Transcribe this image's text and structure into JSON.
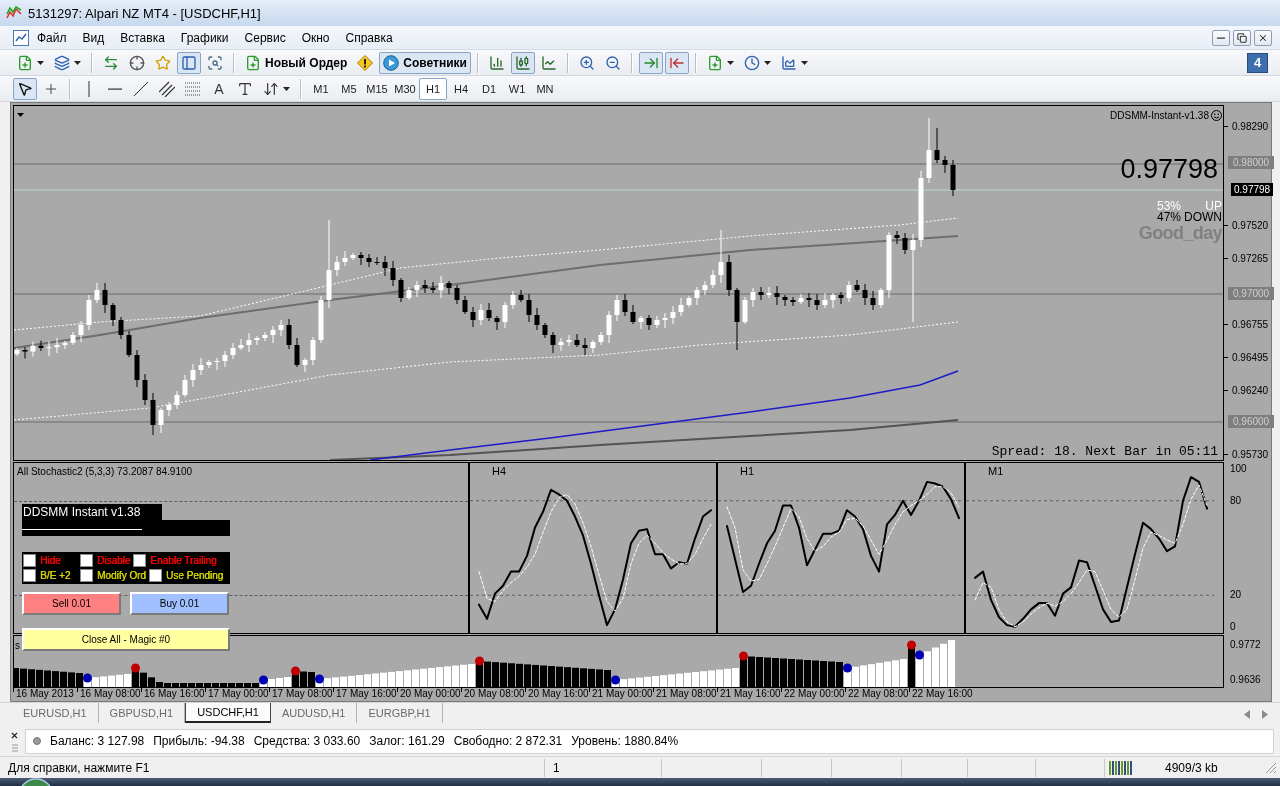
{
  "window": {
    "title": "5131297: Alpari NZ MT4 - [USDCHF,H1]"
  },
  "menu": [
    "Файл",
    "Вид",
    "Вставка",
    "Графики",
    "Сервис",
    "Окно",
    "Справка"
  ],
  "toolbar": {
    "groups": [
      [
        {
          "kind": "icon",
          "pressed": false,
          "dropdown": true
        },
        {
          "kind": "icon",
          "pressed": false,
          "dropdown": true
        }
      ],
      [
        {
          "kind": "icon",
          "pressed": false
        },
        {
          "kind": "icon",
          "pressed": false
        },
        {
          "kind": "icon",
          "pressed": false
        },
        {
          "kind": "icon",
          "pressed": true
        },
        {
          "kind": "icon",
          "pressed": false
        }
      ],
      [
        {
          "kind": "text",
          "label": "Новый Ордер",
          "pressed": false
        },
        {
          "kind": "icon",
          "pressed": false
        },
        {
          "kind": "text",
          "label": "Советники",
          "pressed": true
        }
      ],
      [
        {
          "kind": "icon",
          "pressed": false
        },
        {
          "kind": "icon",
          "pressed": true
        },
        {
          "kind": "icon",
          "pressed": false
        }
      ],
      [
        {
          "kind": "icon",
          "pressed": false
        },
        {
          "kind": "icon",
          "pressed": false
        }
      ],
      [
        {
          "kind": "icon",
          "pressed": true
        },
        {
          "kind": "icon",
          "pressed": true
        }
      ],
      [
        {
          "kind": "icon",
          "pressed": false,
          "dropdown": true
        },
        {
          "kind": "icon",
          "pressed": false,
          "dropdown": true
        },
        {
          "kind": "icon",
          "pressed": false,
          "dropdown": true
        }
      ]
    ],
    "badge": "4"
  },
  "drawing_toolbar": {
    "groups": [
      [
        {
          "kind": "icon",
          "pressed": true
        },
        {
          "kind": "icon",
          "pressed": false
        }
      ],
      [
        {
          "kind": "icon",
          "pressed": false
        },
        {
          "kind": "icon",
          "pressed": false
        },
        {
          "kind": "icon",
          "pressed": false
        },
        {
          "kind": "icon",
          "pressed": false
        },
        {
          "kind": "icon",
          "pressed": false
        },
        {
          "kind": "glyph",
          "label": "A",
          "pressed": false
        },
        {
          "kind": "icon",
          "pressed": false
        },
        {
          "kind": "icon",
          "pressed": false,
          "dropdown": true
        }
      ]
    ],
    "timeframes": [
      {
        "label": "M1",
        "selected": false
      },
      {
        "label": "M5",
        "selected": false
      },
      {
        "label": "M15",
        "selected": false
      },
      {
        "label": "M30",
        "selected": false
      },
      {
        "label": "H1",
        "selected": true
      },
      {
        "label": "H4",
        "selected": false
      },
      {
        "label": "D1",
        "selected": false
      },
      {
        "label": "W1",
        "selected": false
      },
      {
        "label": "MN",
        "selected": false
      }
    ]
  },
  "chart": {
    "indicator_name": "DDSMM-Instant-v1.38",
    "price": "0.97798",
    "trend": [
      {
        "percent": "53%",
        "label": "UP",
        "color": "#ffffff"
      },
      {
        "percent": "47%",
        "label": "DOWN",
        "color": "#000000"
      }
    ],
    "signal": "Good_day",
    "spread_info": "Spread: 18. Next Bar in 05:11",
    "price_axis": [
      {
        "label": "0.98290",
        "kind": "tick"
      },
      {
        "label": "0.98000",
        "kind": "level"
      },
      {
        "label": "0.97798",
        "kind": "bid"
      },
      {
        "label": "0.97520",
        "kind": "tick"
      },
      {
        "label": "0.97265",
        "kind": "tick"
      },
      {
        "label": "0.97000",
        "kind": "level"
      },
      {
        "label": "0.96755",
        "kind": "tick"
      },
      {
        "label": "0.96495",
        "kind": "tick"
      },
      {
        "label": "0.96240",
        "kind": "tick"
      },
      {
        "label": "0.96000",
        "kind": "level"
      },
      {
        "label": "0.95730",
        "kind": "tick"
      }
    ]
  },
  "stochastic": {
    "title": "All Stochastic2 (5,3,3) 73.2087 84.9100",
    "panels": [
      {
        "title": "H4"
      },
      {
        "title": "H1"
      },
      {
        "chart_data": {
          "type": "line",
          "title": "M1",
          "ylim": [
            -4,
            104
          ],
          "yticks": [
            0,
            20,
            80,
            100
          ],
          "categories": [
            null,
            null,
            null,
            null,
            null,
            null,
            null,
            null,
            null,
            null,
            null,
            null,
            null,
            null,
            null,
            null,
            null,
            null,
            null,
            null,
            null,
            null,
            null,
            null,
            null,
            null,
            null,
            null,
            null,
            null
          ],
          "series": [
            {
              "color": "#000000",
              "line_style": "solid",
              "values": [
                31,
                35,
                17,
                6,
                1,
                0,
                5,
                11,
                15,
                15,
                7,
                21,
                25,
                42,
                41,
                26,
                11,
                3,
                4,
                25,
                46,
                66,
                62,
                56,
                48,
                51,
                80,
                95,
                92,
                75
              ]
            },
            {
              "color": "#ffffff",
              "line_style": "dashed",
              "values": [
                17,
                28,
                25,
                11,
                3,
                0,
                3,
                8,
                12,
                15,
                13,
                16,
                21,
                28,
                36,
                35,
                23,
                11,
                6,
                11,
                30,
                50,
                60,
                58,
                55,
                53,
                65,
                81,
                90,
                77
              ]
            }
          ]
        }
      }
    ]
  },
  "trade_panel": {
    "title": "DDSMM Instant v1.38",
    "options": [
      [
        {
          "label": "Hide",
          "checked": false,
          "color": "#ff0000"
        },
        {
          "label": "Disable",
          "checked": false,
          "color": "#ff0000"
        },
        {
          "label": "Enable Trailing",
          "checked": false,
          "color": "#ff0000"
        }
      ],
      [
        {
          "label": "B/E +2",
          "checked": false,
          "color": "#d2d200"
        },
        {
          "label": "Modify Ord",
          "checked": false,
          "color": "#d2d200"
        },
        {
          "label": "Use Pending",
          "checked": false,
          "color": "#d2d200"
        }
      ]
    ],
    "buttons": [
      {
        "label": "Sell 0.01",
        "color": "#ff8080"
      },
      {
        "label": "Buy 0.01",
        "color": "#a0c0ff"
      },
      {
        "label": "Close All - Magic #0",
        "color": "#ffffa0"
      }
    ]
  },
  "histogram": {
    "label": "s",
    "axis": [
      "0.9772",
      "0.9636"
    ]
  },
  "time_axis": [
    "16 May 2013",
    "16 May 08:00",
    "16 May 16:00",
    "17 May 00:00",
    "17 May 08:00",
    "17 May 16:00",
    "20 May 00:00",
    "20 May 08:00",
    "20 May 16:00",
    "21 May 00:00",
    "21 May 08:00",
    "21 May 16:00",
    "22 May 00:00",
    "22 May 08:00",
    "22 May 16:00"
  ],
  "symbol_tabs": [
    {
      "label": "EURUSD,H1",
      "selected": false
    },
    {
      "label": "GBPUSD,H1",
      "selected": false
    },
    {
      "label": "USDCHF,H1",
      "selected": true
    },
    {
      "label": "AUDUSD,H1",
      "selected": false
    },
    {
      "label": "EURGBP,H1",
      "selected": false
    }
  ],
  "terminal": {
    "items": [
      "Баланс: 3 127.98",
      "Прибыль: -94.38",
      "Средства: 3 033.60",
      "Залог: 161.29",
      "Свободно: 2 872.31",
      "Уровень: 1880.84%"
    ]
  },
  "status_bar": {
    "help": "Для справки, нажмите F1",
    "profile": "1",
    "traffic": "4909/3 kb"
  }
}
